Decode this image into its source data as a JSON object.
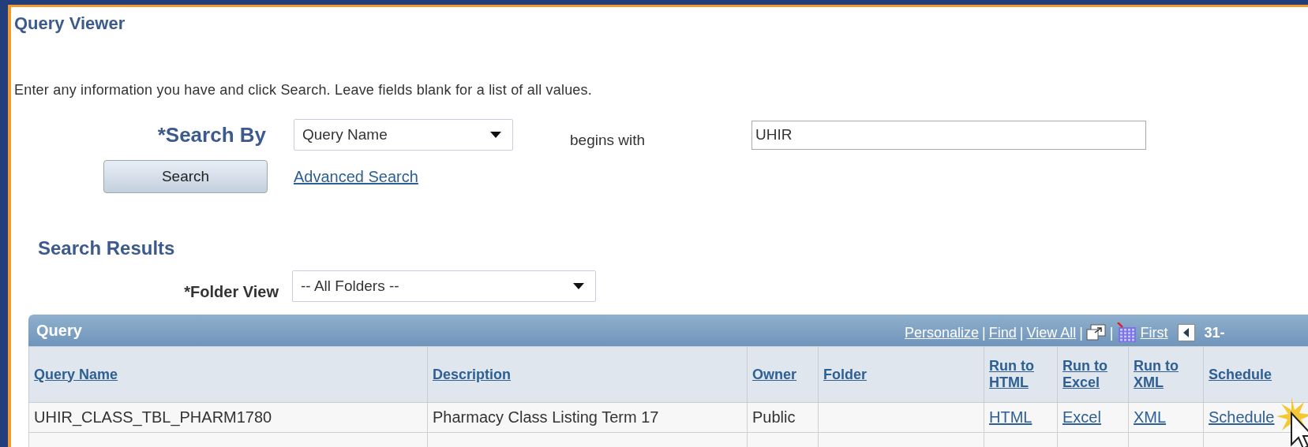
{
  "title": "Query Viewer",
  "instructions": "Enter any information you have and click Search. Leave fields blank for a list of all values.",
  "search": {
    "label": "*Search By",
    "field": "Query Name",
    "operator": "begins with",
    "value": "UHIR",
    "button": "Search",
    "advanced_link": "Advanced Search"
  },
  "results": {
    "title": "Search Results",
    "folder_view": {
      "label": "*Folder View",
      "value": "-- All Folders --"
    },
    "grid": {
      "title": "Query",
      "toolbar": [
        {
          "kind": "link",
          "text": "Personalize"
        },
        {
          "kind": "separator",
          "text": "|"
        },
        {
          "kind": "link",
          "text": "Find"
        },
        {
          "kind": "separator",
          "text": "|"
        },
        {
          "kind": "link",
          "text": "View All"
        },
        {
          "kind": "separator",
          "text": "|"
        },
        {
          "kind": "popout"
        },
        {
          "kind": "separator",
          "text": "|"
        },
        {
          "kind": "download"
        },
        {
          "kind": "link",
          "text": "First"
        },
        {
          "kind": "previous"
        },
        {
          "kind": "range",
          "text": "31-"
        }
      ],
      "columns": [
        "Query Name",
        "Description",
        "Owner",
        "Folder",
        "Run to HTML",
        "Run to Excel",
        "Run to XML",
        "Schedule"
      ],
      "rows": [
        {
          "cells": [
            {
              "kind": "text",
              "text": "UHIR_CLASS_TBL_PHARM1780"
            },
            {
              "kind": "text",
              "text": "Pharmacy Class Listing Term 17"
            },
            {
              "kind": "text",
              "text": "Public"
            },
            {
              "kind": "text",
              "text": ""
            },
            {
              "kind": "link",
              "text": "HTML"
            },
            {
              "kind": "link",
              "text": "Excel"
            },
            {
              "kind": "link",
              "text": "XML"
            },
            {
              "kind": "link",
              "text": "Schedule"
            }
          ]
        }
      ]
    }
  }
}
